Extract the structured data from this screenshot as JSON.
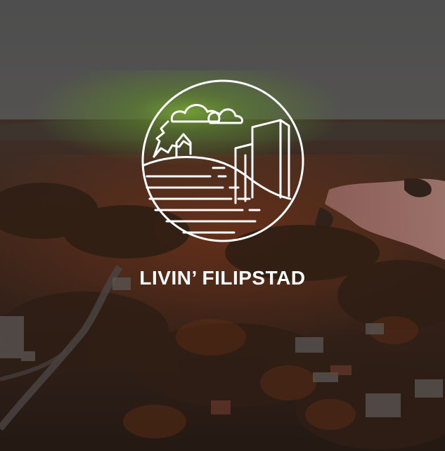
{
  "brand": {
    "title": "LIVIN’ FILIPSTAD"
  },
  "icons": {
    "logo": "town-landscape-emblem-icon"
  },
  "colors": {
    "overlay": "#616161",
    "text": "#ffffff",
    "sun_glow": "#7fbf3a",
    "foliage_warm": "#7a3a1c",
    "lake": "#c98f88"
  }
}
